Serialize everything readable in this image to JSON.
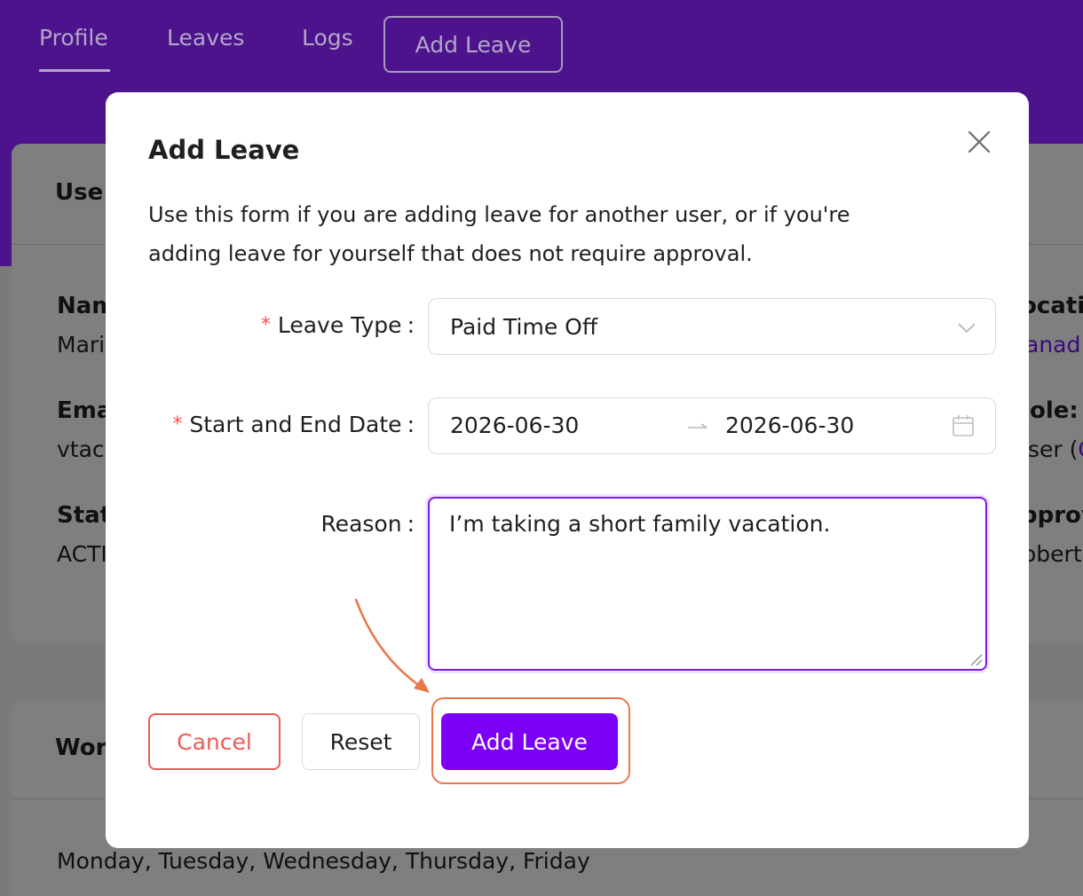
{
  "nav": {
    "tabs": [
      {
        "label": "Profile"
      },
      {
        "label": "Leaves"
      },
      {
        "label": "Logs"
      }
    ],
    "add_leave_label": "Add Leave"
  },
  "background": {
    "card1_title": "Use",
    "name_label": "Nam",
    "name_value": "Mari",
    "email_label": "Ema",
    "email_value": "vtac",
    "status_label": "Stat",
    "status_value": "ACTI",
    "location_label": "ocati",
    "location_value": "anad",
    "role_label": "ole:",
    "role_value": "ser (",
    "role_link": "C",
    "approver_label": "pprov",
    "approver_value": "obert",
    "card2_title": "Wor",
    "work_days": "Monday, Tuesday, Wednesday, Thursday, Friday"
  },
  "modal": {
    "title": "Add Leave",
    "description_line1": "Use this form if you are adding leave for another user, or if you're",
    "description_line2": "adding leave for yourself that does not require approval.",
    "leave_type": {
      "label": "Leave Type",
      "value": "Paid Time Off"
    },
    "dates": {
      "label": "Start and End Date",
      "start": "2026-06-30",
      "end": "2026-06-30"
    },
    "reason": {
      "label": "Reason",
      "value": "I’m taking a short family vacation."
    },
    "buttons": {
      "cancel": "Cancel",
      "reset": "Reset",
      "add": "Add Leave"
    }
  },
  "colors": {
    "header_purple": "#4c138d",
    "primary": "#7c00f5",
    "danger": "#ef5b57",
    "annotation": "#e9774a"
  },
  "icons": [
    "close-icon",
    "chevron-down-icon",
    "arrow-right-icon",
    "calendar-icon",
    "resize-handle-icon"
  ]
}
